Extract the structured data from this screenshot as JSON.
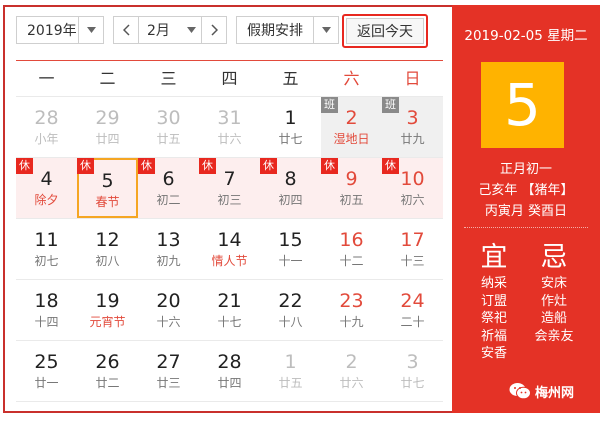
{
  "toolbar": {
    "year": "2019年",
    "month": "2月",
    "holiday": "假期安排",
    "today_button": "返回今天"
  },
  "weekdays": [
    "一",
    "二",
    "三",
    "四",
    "五",
    "六",
    "日"
  ],
  "weeks": [
    [
      {
        "day": "28",
        "lunar": "小年",
        "other": true
      },
      {
        "day": "29",
        "lunar": "廿四",
        "other": true
      },
      {
        "day": "30",
        "lunar": "廿五",
        "other": true
      },
      {
        "day": "31",
        "lunar": "廿六",
        "other": true
      },
      {
        "day": "1",
        "lunar": "廿七"
      },
      {
        "day": "2",
        "lunar": "湿地日",
        "weekend": true,
        "festival": true,
        "badge": "班",
        "badgeType": "work"
      },
      {
        "day": "3",
        "lunar": "廿九",
        "weekend": true,
        "badge": "班",
        "badgeType": "work"
      }
    ],
    [
      {
        "day": "4",
        "lunar": "除夕",
        "festival": true,
        "badge": "休",
        "badgeType": "rest"
      },
      {
        "day": "5",
        "lunar": "春节",
        "festival": true,
        "badge": "休",
        "badgeType": "rest",
        "selected": true
      },
      {
        "day": "6",
        "lunar": "初二",
        "badge": "休",
        "badgeType": "rest"
      },
      {
        "day": "7",
        "lunar": "初三",
        "badge": "休",
        "badgeType": "rest"
      },
      {
        "day": "8",
        "lunar": "初四",
        "badge": "休",
        "badgeType": "rest"
      },
      {
        "day": "9",
        "lunar": "初五",
        "weekend": true,
        "badge": "休",
        "badgeType": "rest"
      },
      {
        "day": "10",
        "lunar": "初六",
        "weekend": true,
        "badge": "休",
        "badgeType": "rest"
      }
    ],
    [
      {
        "day": "11",
        "lunar": "初七"
      },
      {
        "day": "12",
        "lunar": "初八"
      },
      {
        "day": "13",
        "lunar": "初九"
      },
      {
        "day": "14",
        "lunar": "情人节",
        "festival": true
      },
      {
        "day": "15",
        "lunar": "十一"
      },
      {
        "day": "16",
        "lunar": "十二",
        "weekend": true
      },
      {
        "day": "17",
        "lunar": "十三",
        "weekend": true
      }
    ],
    [
      {
        "day": "18",
        "lunar": "十四"
      },
      {
        "day": "19",
        "lunar": "元宵节",
        "festival": true
      },
      {
        "day": "20",
        "lunar": "十六"
      },
      {
        "day": "21",
        "lunar": "十七"
      },
      {
        "day": "22",
        "lunar": "十八"
      },
      {
        "day": "23",
        "lunar": "十九",
        "weekend": true
      },
      {
        "day": "24",
        "lunar": "二十",
        "weekend": true
      }
    ],
    [
      {
        "day": "25",
        "lunar": "廿一"
      },
      {
        "day": "26",
        "lunar": "廿二"
      },
      {
        "day": "27",
        "lunar": "廿三"
      },
      {
        "day": "28",
        "lunar": "廿四"
      },
      {
        "day": "1",
        "lunar": "廿五",
        "other": true
      },
      {
        "day": "2",
        "lunar": "廿六",
        "other": true
      },
      {
        "day": "3",
        "lunar": "廿七",
        "other": true
      }
    ]
  ],
  "panel": {
    "date_header": "2019-02-05 星期二",
    "big_day": "5",
    "lunar_date": "正月初一",
    "year_ganzhi": "己亥年 【猪年】",
    "month_day_ganzhi": "丙寅月 癸酉日",
    "yi_title": "宜",
    "ji_title": "忌",
    "yi_items": [
      "纳采",
      "订盟",
      "祭祀",
      "祈福",
      "安香"
    ],
    "ji_items": [
      "安床",
      "作灶",
      "造船",
      "会亲友"
    ]
  },
  "watermark": "梅州网",
  "colors": {
    "accent_red": "#e43226",
    "highlight_yellow": "#ffb300",
    "rest_badge": "#e8281f",
    "work_badge": "#8a8a8a"
  }
}
